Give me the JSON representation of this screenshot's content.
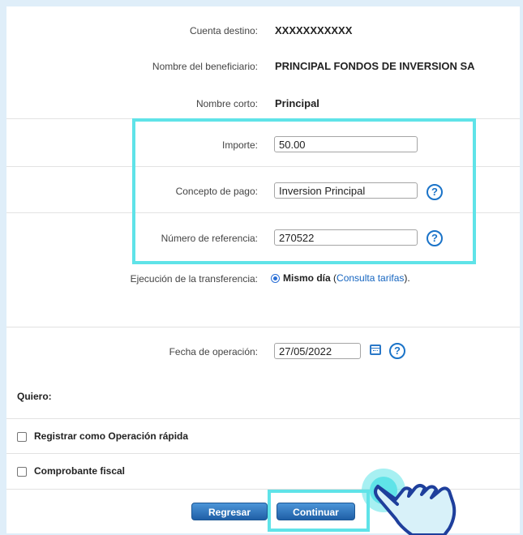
{
  "destination": {
    "label": "Cuenta destino:",
    "value": "XXXXXXXXXXX"
  },
  "beneficiary": {
    "label": "Nombre del beneficiario:",
    "value": "PRINCIPAL FONDOS DE INVERSION SA"
  },
  "short_name": {
    "label": "Nombre corto:",
    "value": "Principal"
  },
  "amount": {
    "label": "Importe:",
    "value": "50.00"
  },
  "concept": {
    "label": "Concepto de pago:",
    "value": "Inversion Principal"
  },
  "reference": {
    "label": "Número de referencia:",
    "value": "270522"
  },
  "help_glyph": "?",
  "execution": {
    "label": "Ejecución de la transferencia:",
    "option": "Mismo día",
    "open_paren": " (",
    "link": "Consulta tarifas",
    "close_paren": ")."
  },
  "operation_date": {
    "label": "Fecha de operación:",
    "value": "27/05/2022"
  },
  "quiero": {
    "label": "Quiero:"
  },
  "options": [
    {
      "label": "Registrar como Operación rápida",
      "checked": false
    },
    {
      "label": "Comprobante fiscal",
      "checked": false
    }
  ],
  "buttons": {
    "back": "Regresar",
    "continue": "Continuar"
  },
  "colors": {
    "highlight": "#5fe3e8",
    "button": "#2a6fbd",
    "link": "#1565c0"
  }
}
